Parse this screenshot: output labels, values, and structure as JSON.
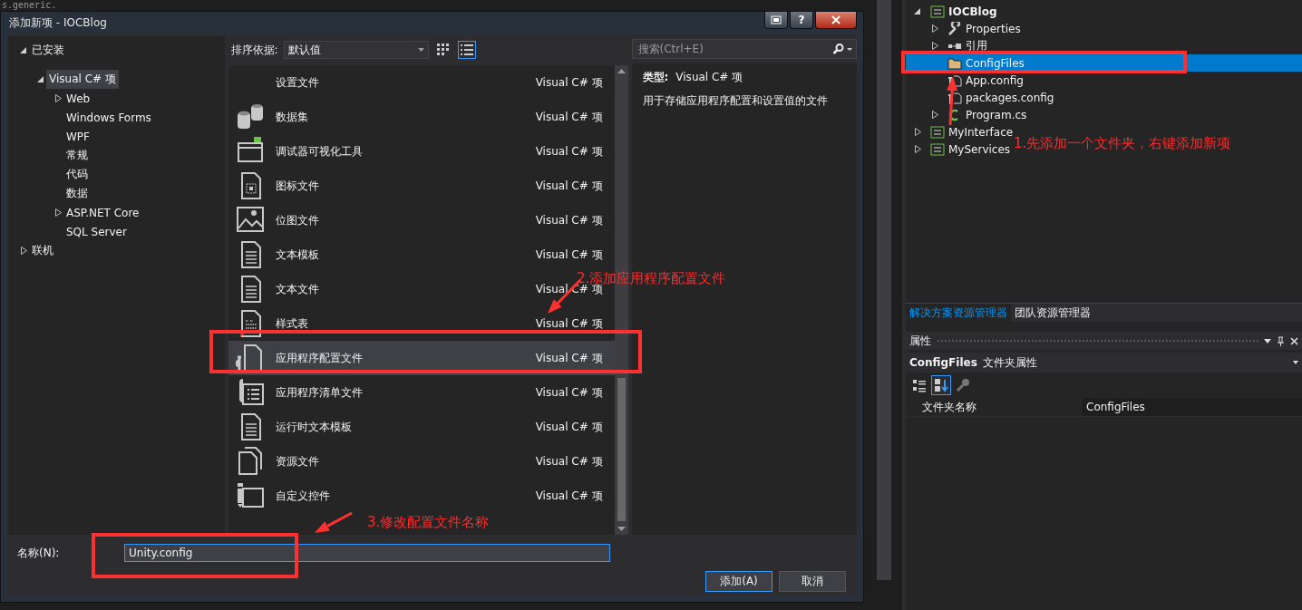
{
  "editor_text": "s.generic.",
  "dialog": {
    "title": "添加新项 - IOCBlog",
    "help_button": "?",
    "category_tree": [
      {
        "label": "已安装",
        "expanded": true,
        "selected": false,
        "children": [
          {
            "label": "Visual C# 项",
            "expanded": true,
            "selected": true,
            "children": [
              {
                "label": "Web",
                "expanded": false,
                "selected": false
              },
              {
                "label": "Windows Forms",
                "selected": false
              },
              {
                "label": "WPF",
                "selected": false
              },
              {
                "label": "常规",
                "selected": false
              },
              {
                "label": "代码",
                "selected": false
              },
              {
                "label": "数据",
                "selected": false
              },
              {
                "label": "ASP.NET Core",
                "expanded": false,
                "selected": false
              },
              {
                "label": "SQL Server",
                "selected": false
              }
            ]
          }
        ]
      },
      {
        "label": "联机",
        "expanded": false,
        "selected": false
      }
    ],
    "sort": {
      "label": "排序依据:",
      "value": "默认值"
    },
    "view_modes": [
      {
        "kind": "grid",
        "selected": false
      },
      {
        "kind": "list",
        "selected": true
      }
    ],
    "search": {
      "placeholder": "搜索(Ctrl+E)"
    },
    "templates": [
      {
        "name": "设置文件",
        "type": "Visual C# 项",
        "kind": "plain",
        "selected": false
      },
      {
        "name": "数据集",
        "type": "Visual C# 项",
        "kind": "database",
        "selected": false
      },
      {
        "name": "调试器可视化工具",
        "type": "Visual C# 项",
        "kind": "visualizer",
        "selected": false
      },
      {
        "name": "图标文件",
        "type": "Visual C# 项",
        "kind": "icon_file",
        "selected": false
      },
      {
        "name": "位图文件",
        "type": "Visual C# 项",
        "kind": "bitmap",
        "selected": false
      },
      {
        "name": "文本模板",
        "type": "Visual C# 项",
        "kind": "text_doc",
        "selected": false
      },
      {
        "name": "文本文件",
        "type": "Visual C# 项",
        "kind": "text_doc",
        "selected": false
      },
      {
        "name": "样式表",
        "type": "Visual C# 项",
        "kind": "stylesheet",
        "selected": false
      },
      {
        "name": "应用程序配置文件",
        "type": "Visual C# 项",
        "kind": "app_config",
        "selected": true
      },
      {
        "name": "应用程序清单文件",
        "type": "Visual C# 项",
        "kind": "manifest",
        "selected": false
      },
      {
        "name": "运行时文本模板",
        "type": "Visual C# 项",
        "kind": "text_doc",
        "selected": false
      },
      {
        "name": "资源文件",
        "type": "Visual C# 项",
        "kind": "resource",
        "selected": false
      },
      {
        "name": "自定义控件",
        "type": "Visual C# 项",
        "kind": "user_control",
        "selected": false
      }
    ],
    "details": {
      "type_label": "类型:",
      "type_value": "Visual C# 项",
      "description": "用于存储应用程序配置和设置值的文件"
    },
    "name_field": {
      "label": "名称(N):",
      "value": "Unity.config"
    },
    "buttons": [
      {
        "label": "添加(A)",
        "default": true
      },
      {
        "label": "取消",
        "default": false
      }
    ]
  },
  "solution_tree": [
    {
      "label": "IOCBlog",
      "kind": "project",
      "expanded": true,
      "selected": false,
      "children": [
        {
          "label": "Properties",
          "kind": "wrench",
          "expanded": false,
          "selected": false
        },
        {
          "label": "引用",
          "kind": "references",
          "expanded": false,
          "selected": false
        },
        {
          "label": "ConfigFiles",
          "kind": "folder",
          "selected": true
        },
        {
          "label": "App.config",
          "kind": "config",
          "selected": false
        },
        {
          "label": "packages.config",
          "kind": "config",
          "selected": false
        },
        {
          "label": "Program.cs",
          "kind": "csharp",
          "expanded": false,
          "selected": false
        }
      ]
    },
    {
      "label": "MyInterface",
      "kind": "project",
      "expanded": false,
      "selected": false
    },
    {
      "label": "MyServices",
      "kind": "project",
      "expanded": false,
      "selected": false
    }
  ],
  "explorer_tabs": [
    {
      "label": "解决方案资源管理器",
      "selected": true
    },
    {
      "label": "团队资源管理器",
      "selected": false
    }
  ],
  "properties": {
    "title": "属性",
    "object_name": "ConfigFiles",
    "object_type": "文件夹属性",
    "toolbar": [
      {
        "kind": "categorized",
        "selected": false
      },
      {
        "kind": "alphabetical",
        "selected": true
      },
      {
        "kind": "property_pages",
        "selected": false
      }
    ],
    "rows": [
      {
        "name": "文件夹名称",
        "value": "ConfigFiles"
      }
    ]
  },
  "annotations": [
    {
      "text": "1.先添加一个文件夹，右键添加新项"
    },
    {
      "text": "2.添加应用程序配置文件"
    },
    {
      "text": "3.修改配置文件名称"
    }
  ]
}
